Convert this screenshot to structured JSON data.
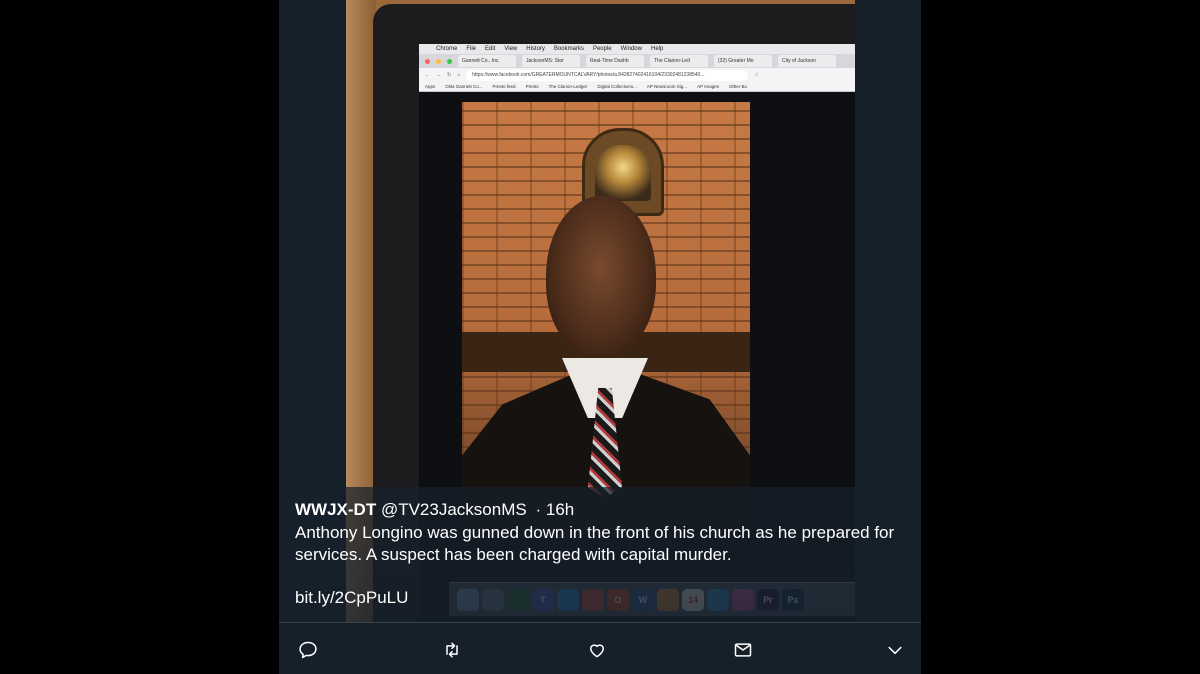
{
  "tweet": {
    "display_name": "WWJX-DT",
    "handle": "@TV23JacksonMS",
    "separator": "·",
    "time": "16h",
    "text": "Anthony Longino was gunned down in the front of his church as he prepared for services. A suspect has been charged with capital murder.",
    "link": "bit.ly/2CpPuLU"
  },
  "screen": {
    "menubar": [
      "Chrome",
      "File",
      "Edit",
      "View",
      "History",
      "Bookmarks",
      "People",
      "Window",
      "Help"
    ],
    "tabs": [
      "Gannett Co., Inc.",
      "JacksonMS: Stor",
      "Real-Time Dashb",
      "The Clarion-Led",
      "(32) Greater Mo",
      "City of Jackson"
    ],
    "url": "https://www.facebook.com/GREATERMOUNTCALVARY/photos/a.842827402416104/23302481238540...",
    "bookmarks": [
      "Apps",
      "Okla Gannett Co...",
      "Presto feed",
      "Presto",
      "The Clarion-Ledger",
      "Digital Collections...",
      "AP Newsroom Sig...",
      "AP Images",
      "Other Bo"
    ]
  },
  "dock_icons": [
    {
      "label": "",
      "color": "#7ea3c7"
    },
    {
      "label": "",
      "color": "#6f7b8f"
    },
    {
      "label": "",
      "color": "#2e6b3a"
    },
    {
      "label": "T",
      "color": "#5059c9"
    },
    {
      "label": "",
      "color": "#2f8fe0"
    },
    {
      "label": "",
      "color": "#e24c3f"
    },
    {
      "label": "O",
      "color": "#d24726"
    },
    {
      "label": "W",
      "color": "#2b579a"
    },
    {
      "label": "",
      "color": "#e08f3a"
    },
    {
      "label": "14",
      "color": "#f1f1f1"
    },
    {
      "label": "",
      "color": "#3a8fd0"
    },
    {
      "label": "",
      "color": "#d54b9c"
    },
    {
      "label": "Pr",
      "color": "#2a0f3d"
    },
    {
      "label": "Ps",
      "color": "#0d2a45"
    }
  ],
  "actions": {
    "reply_icon": "reply-icon",
    "retweet_icon": "retweet-icon",
    "like_icon": "heart-icon",
    "dm_icon": "envelope-icon",
    "more_icon": "chevron-down-icon",
    "icon_color": "#ffffff"
  }
}
